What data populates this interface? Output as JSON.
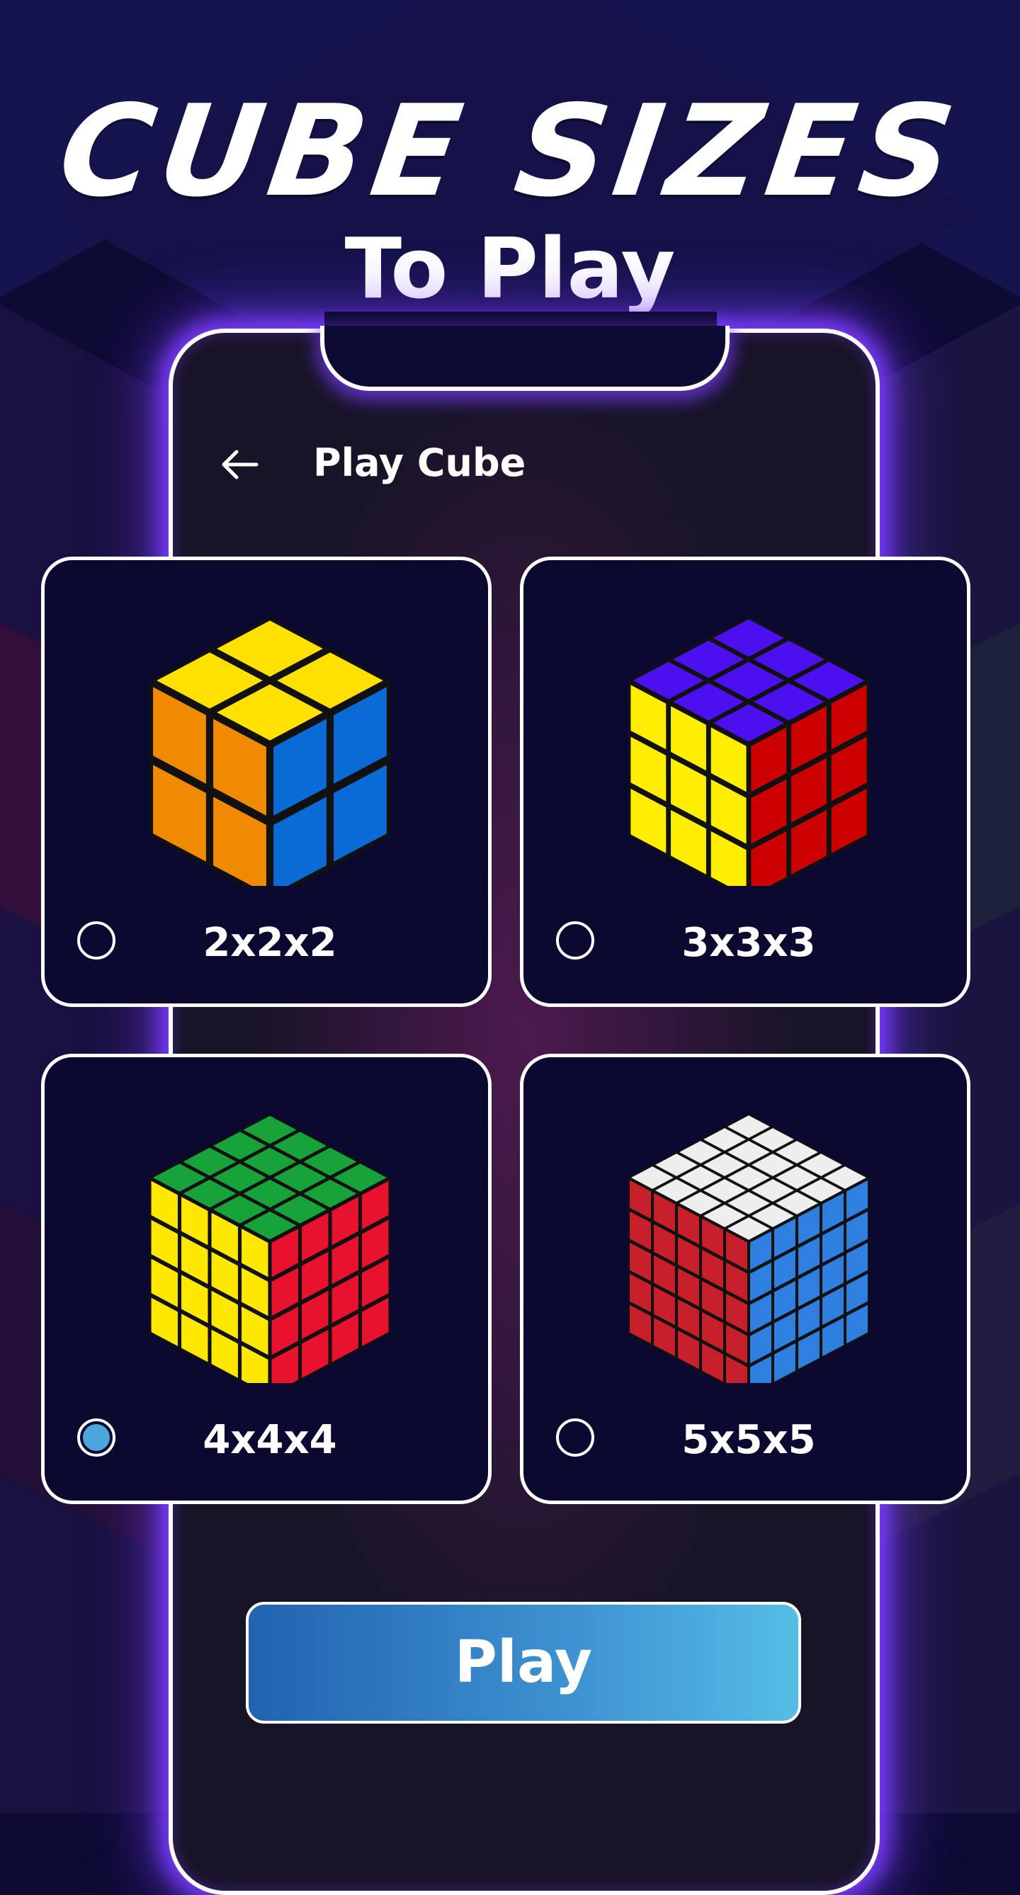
{
  "hero": {
    "title": "CUBE SIZES",
    "subtitle": "To Play"
  },
  "header": {
    "back_icon": "arrow-left-icon",
    "title": "Play Cube"
  },
  "options": [
    {
      "label": "2x2x2",
      "selected": false,
      "colors": {
        "top": "#ffe100",
        "left": "#f08a00",
        "right": "#0a6bd6"
      }
    },
    {
      "label": "3x3x3",
      "selected": false,
      "colors": {
        "top": "#4c10f0",
        "left": "#ffee00",
        "right": "#cc0000"
      }
    },
    {
      "label": "4x4x4",
      "selected": true,
      "colors": {
        "top": "#18a33a",
        "left": "#ffe800",
        "right": "#e8112e"
      }
    },
    {
      "label": "5x5x5",
      "selected": false,
      "colors": {
        "top": "#eeeeee",
        "left": "#c8202a",
        "right": "#2e7fe0"
      }
    }
  ],
  "play_button": {
    "label": "Play"
  },
  "theme": {
    "accent": "#7a3cff",
    "selected_radio": "#4aa6dd",
    "button_start": "#2163b0",
    "button_end": "#55bde6"
  }
}
